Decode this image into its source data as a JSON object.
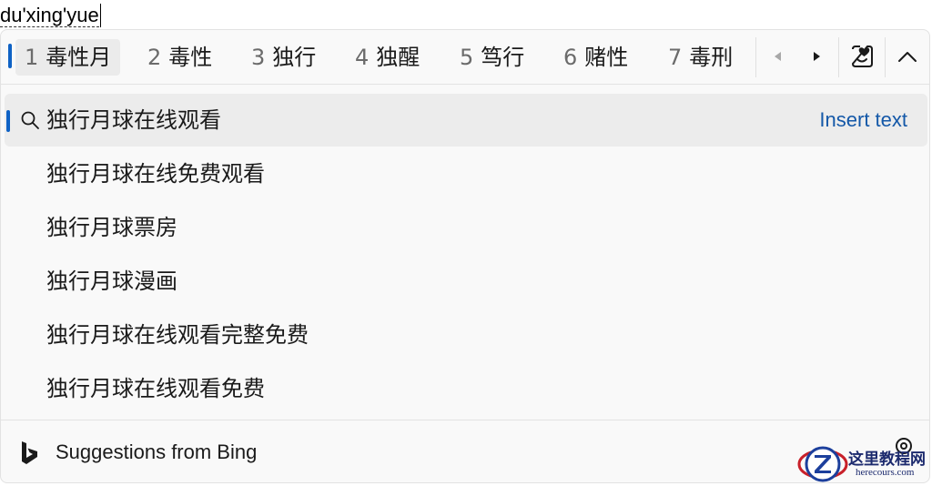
{
  "composition": {
    "pinyin": "du'xing'yue"
  },
  "candidates": [
    {
      "num": "1",
      "text": "毒性月",
      "selected": true
    },
    {
      "num": "2",
      "text": "毒性",
      "selected": false
    },
    {
      "num": "3",
      "text": "独行",
      "selected": false
    },
    {
      "num": "4",
      "text": "独醒",
      "selected": false
    },
    {
      "num": "5",
      "text": "笃行",
      "selected": false
    },
    {
      "num": "6",
      "text": "赌性",
      "selected": false
    },
    {
      "num": "7",
      "text": "毒刑",
      "selected": false
    }
  ],
  "toolbar": {
    "prev_icon": "triangle-left-icon",
    "next_icon": "triangle-right-icon",
    "emoji_icon": "emoji-heart-icon",
    "collapse_icon": "chevron-up-icon"
  },
  "suggestions": {
    "items": [
      {
        "text": "独行月球在线观看",
        "selected": true
      },
      {
        "text": "独行月球在线免费观看",
        "selected": false
      },
      {
        "text": "独行月球票房",
        "selected": false
      },
      {
        "text": "独行月球漫画",
        "selected": false
      },
      {
        "text": "独行月球在线观看完整免费",
        "selected": false
      },
      {
        "text": "独行月球在线观看免费",
        "selected": false
      }
    ],
    "insert_label": "Insert text"
  },
  "footer": {
    "label": "Suggestions from Bing",
    "settings_icon": "gear-icon"
  },
  "watermark": {
    "title": "这里教程网",
    "url": "herecours.com"
  },
  "colors": {
    "accent": "#0f62c5",
    "link": "#1458a8",
    "panel_bg": "#f9f9f9",
    "selected_bg": "#ececec"
  }
}
